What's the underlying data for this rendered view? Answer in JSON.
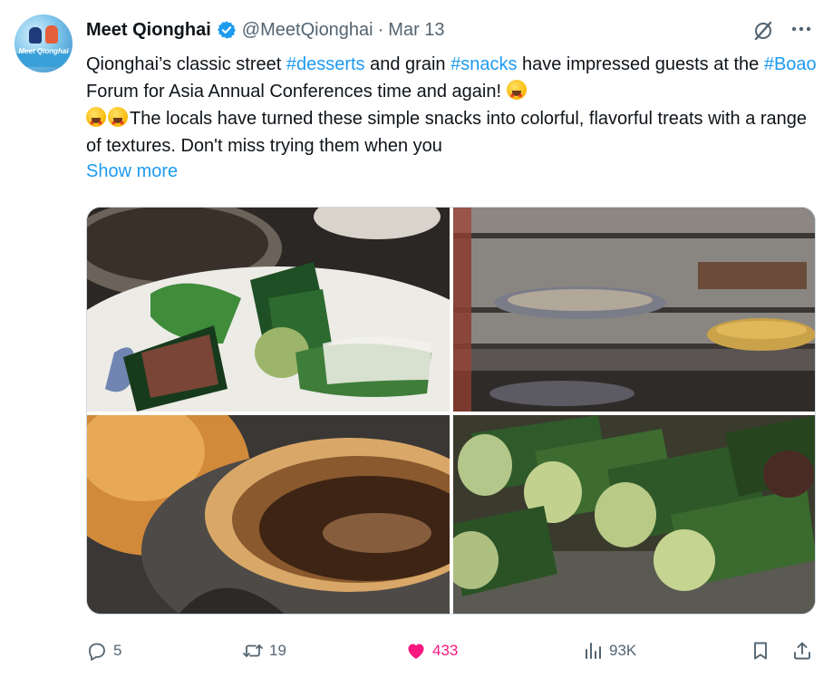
{
  "tweet": {
    "author_name": "Meet Qionghai",
    "handle": "@MeetQionghai",
    "separator": "·",
    "date": "Mar 13",
    "avatar_text": "Meet Qionghai",
    "text_parts": {
      "p1": "Qionghai’s classic street ",
      "tag1": "#desserts",
      "p2": " and grain ",
      "tag2": "#snacks",
      "p3": " have impressed guests at the ",
      "tag3": "#Boao",
      "p4": " Forum for Asia Annual Conferences time and again! ",
      "p5": "The locals have turned these simple snacks into colorful, flavorful treats with a range of textures. Don't miss trying them when you"
    },
    "show_more": "Show more",
    "emoji_name": "star-struck",
    "media_count": 4
  },
  "actions": {
    "replies": "5",
    "reposts": "19",
    "likes": "433",
    "views": "93K"
  },
  "colors": {
    "text": "#0f1419",
    "secondary": "#536471",
    "link": "#1d9bf0",
    "like": "#f91880",
    "verified": "#1d9bf0"
  },
  "icons": [
    "grok-icon",
    "more-icon",
    "reply-icon",
    "repost-icon",
    "heart-icon",
    "views-icon",
    "bookmark-icon",
    "share-icon"
  ]
}
